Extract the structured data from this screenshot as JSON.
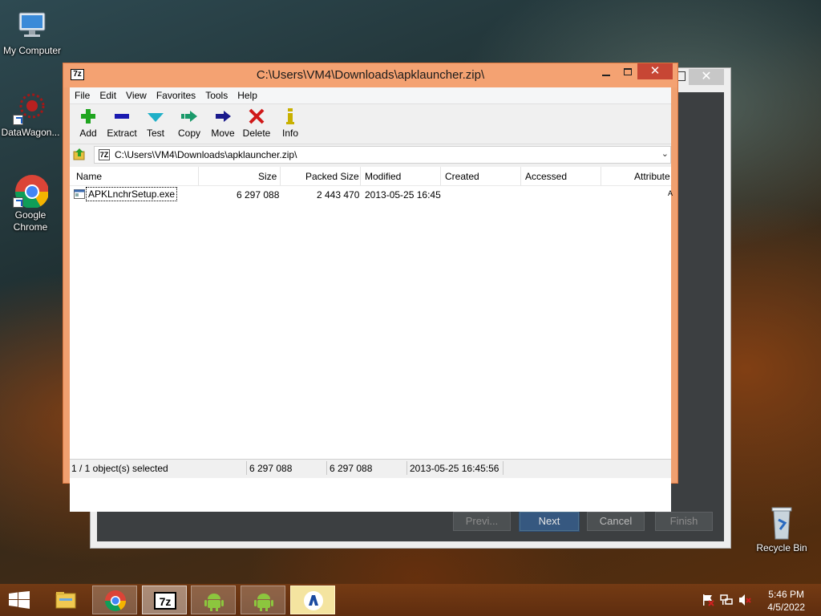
{
  "desktop": {
    "icons": [
      {
        "label": "My Computer"
      },
      {
        "label": "DataWagon..."
      },
      {
        "label": "Google Chrome"
      },
      {
        "label": "Recycle Bin"
      }
    ]
  },
  "wizard": {
    "buttons": {
      "prev": "Previ...",
      "next": "Next",
      "cancel": "Cancel",
      "finish": "Finish"
    }
  },
  "zip_window": {
    "title": "C:\\Users\\VM4\\Downloads\\apklauncher.zip\\",
    "app_icon_text": "7z",
    "menu": [
      "File",
      "Edit",
      "View",
      "Favorites",
      "Tools",
      "Help"
    ],
    "toolbar": [
      {
        "label": "Add",
        "icon": "plus-icon",
        "color": "#1fa51f"
      },
      {
        "label": "Extract",
        "icon": "minus-icon",
        "color": "#1a1ab0"
      },
      {
        "label": "Test",
        "icon": "check-icon",
        "color": "#1fb0c8"
      },
      {
        "label": "Copy",
        "icon": "copy-arrow-icon",
        "color": "#1a9a6a"
      },
      {
        "label": "Move",
        "icon": "move-arrow-icon",
        "color": "#1a1a8c"
      },
      {
        "label": "Delete",
        "icon": "x-icon",
        "color": "#d01818"
      },
      {
        "label": "Info",
        "icon": "info-icon",
        "color": "#c8b000"
      }
    ],
    "address": "C:\\Users\\VM4\\Downloads\\apklauncher.zip\\",
    "columns": [
      "Name",
      "Size",
      "Packed Size",
      "Modified",
      "Created",
      "Accessed",
      "Attribute"
    ],
    "rows": [
      {
        "name": "APKLnchrSetup.exe",
        "size": "6 297 088",
        "packed": "2 443 470",
        "modified": "2013-05-25 16:45",
        "created": "",
        "accessed": "",
        "attr": "A"
      }
    ],
    "status": {
      "selection": "1 / 1 object(s) selected",
      "size": "6 297 088",
      "packed": "6 297 088",
      "modified": "2013-05-25 16:45:56"
    }
  },
  "taskbar": {
    "items": [
      "file-explorer",
      "chrome",
      "7zip",
      "android-1",
      "android-2",
      "apk-launcher"
    ],
    "time": "5:46 PM",
    "date": "4/5/2022"
  }
}
